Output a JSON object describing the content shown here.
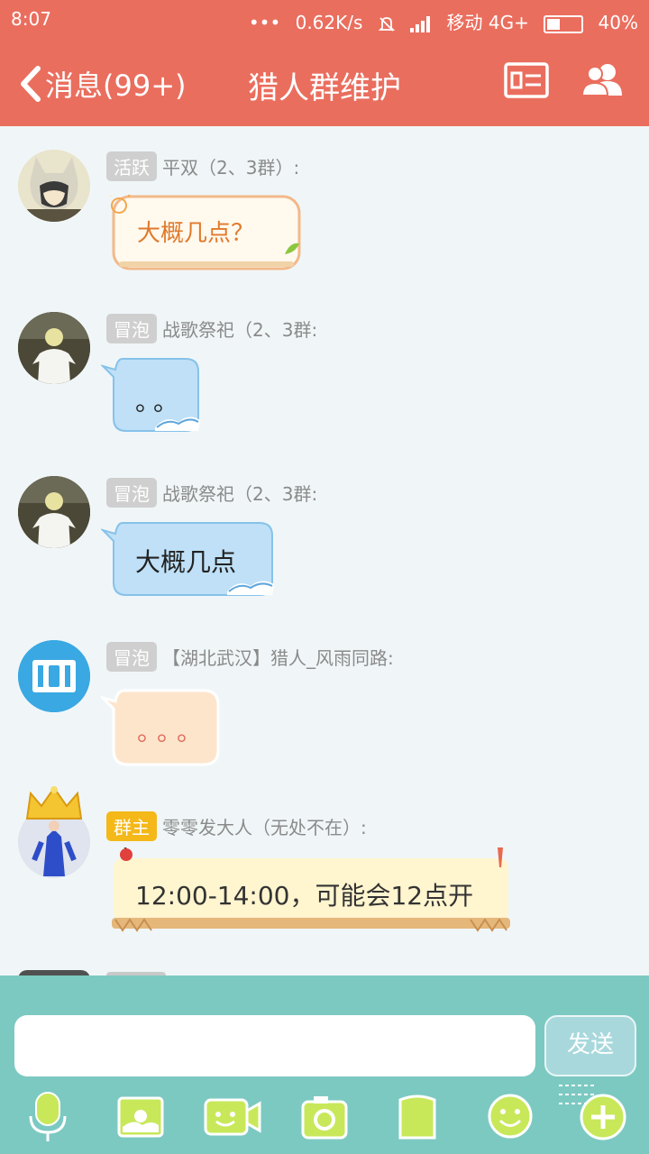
{
  "status_bar": {
    "time": "8:07",
    "dots": "•••",
    "speed": "0.62K/s",
    "carrier": "移动 4G+",
    "battery": "40%",
    "battery_level": 0.4
  },
  "header": {
    "back_label": "消息(99+)",
    "title": "猎人群维护",
    "profile_icon": "id-card-icon",
    "members_icon": "group-members-icon"
  },
  "messages": [
    {
      "badge": "活跃",
      "sender": "平双（2、3群）:",
      "text": "大概几点？",
      "style": "sun-bubble"
    },
    {
      "badge": "冒泡",
      "sender": "战歌祭祀（2、3群:",
      "text": "。。",
      "style": "wave-bubble"
    },
    {
      "badge": "冒泡",
      "sender": "战歌祭祀（2、3群:",
      "text": "大概几点",
      "style": "wave-bubble"
    },
    {
      "badge": "冒泡",
      "sender": "【湖北武汉】猎人_风雨同路:",
      "text": "。。。",
      "style": "peach-bubble"
    },
    {
      "badge": "群主",
      "sender": "零零发大人（无处不在）:",
      "text": "12:00-14:00，可能会12点开",
      "style": "scroll-bubble"
    }
  ],
  "input": {
    "placeholder": "",
    "send_label": "发送"
  },
  "toolbar": [
    "mic-icon",
    "image-icon",
    "video-icon",
    "camera-icon",
    "file-icon",
    "emoji-icon",
    "plus-icon"
  ],
  "colors": {
    "header": "#ea6e5e",
    "input_bar": "#7cc9c2",
    "owner_badge": "#f4b819",
    "member_badge": "#cfcfcf"
  }
}
